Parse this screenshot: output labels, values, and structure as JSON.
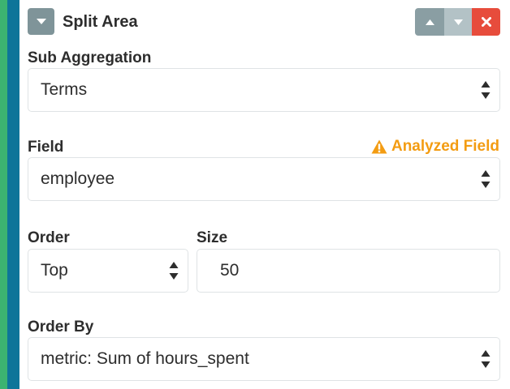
{
  "header": {
    "title": "Split Area",
    "collapse_icon": "caret-down-icon",
    "move_up_icon": "caret-up-icon",
    "move_down_icon": "caret-down-icon",
    "remove_icon": "close-icon"
  },
  "sub_aggregation": {
    "label": "Sub Aggregation",
    "value": "Terms"
  },
  "field": {
    "label": "Field",
    "value": "employee",
    "warning": "Analyzed Field",
    "warning_icon": "warning-triangle-icon"
  },
  "order": {
    "label": "Order",
    "value": "Top"
  },
  "size": {
    "label": "Size",
    "value": "50"
  },
  "order_by": {
    "label": "Order By",
    "value": "metric: Sum of hours_spent"
  },
  "colors": {
    "stripe_green": "#3cb371",
    "stripe_blue": "#0d7599",
    "remove_red": "#e74c3c",
    "warning_orange": "#f39c12",
    "button_gray": "#7f9499"
  }
}
